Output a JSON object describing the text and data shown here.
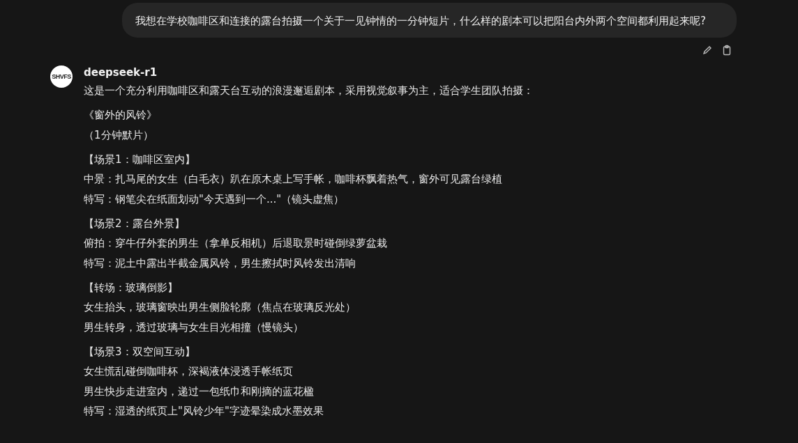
{
  "user_message": {
    "text": "我想在学校咖啡区和连接的露台拍摄一个关于一见钟情的一分钟短片，什么样的剧本可以把阳台内外两个空间都利用起来呢?"
  },
  "reply": {
    "avatar_text": "SHVFS",
    "model": "deepseek-r1",
    "paragraphs": [
      [
        "这是一个充分利用咖啡区和露天台互动的浪漫邂逅剧本，采用视觉叙事为主，适合学生团队拍摄："
      ],
      [
        "《窗外的风铃》",
        "（1分钟默片）"
      ],
      [
        "【场景1：咖啡区室内】",
        "中景：扎马尾的女生（白毛衣）趴在原木桌上写手帐，咖啡杯飘着热气，窗外可见露台绿植",
        "特写：钢笔尖在纸面划动\"今天遇到一个...\"（镜头虚焦）"
      ],
      [
        "【场景2：露台外景】",
        "俯拍：穿牛仔外套的男生（拿单反相机）后退取景时碰倒绿萝盆栽",
        "特写：泥土中露出半截金属风铃，男生擦拭时风铃发出清响"
      ],
      [
        "【转场：玻璃倒影】",
        "女生抬头，玻璃窗映出男生侧脸轮廓（焦点在玻璃反光处）",
        "男生转身，透过玻璃与女生目光相撞（慢镜头）"
      ],
      [
        "【场景3：双空间互动】",
        "女生慌乱碰倒咖啡杯，深褐液体浸透手帐纸页",
        "男生快步走进室内，递过一包纸巾和刚摘的蓝花楹",
        "特写：湿透的纸页上\"风铃少年\"字迹晕染成水墨效果"
      ]
    ]
  }
}
